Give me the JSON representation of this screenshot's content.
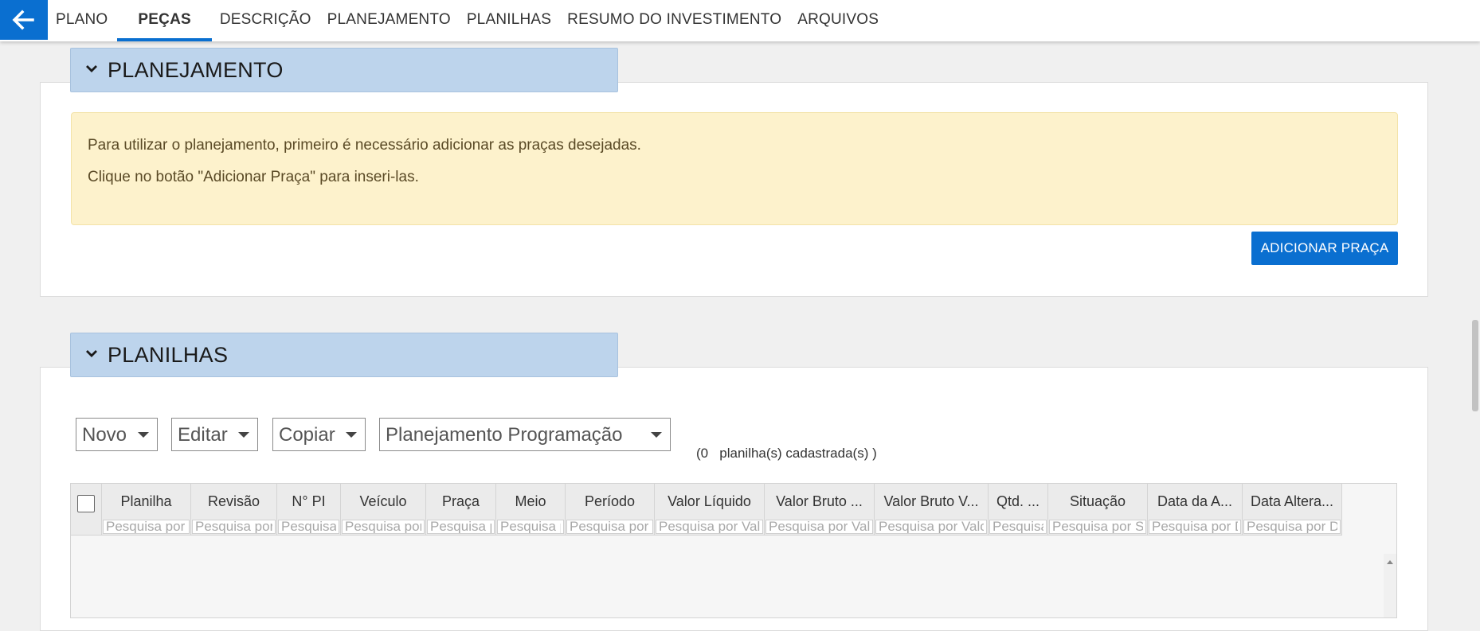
{
  "nav": {
    "tabs": [
      {
        "label": "PLANO"
      },
      {
        "label": "PEÇAS",
        "active": true
      },
      {
        "label": "DESCRIÇÃO"
      },
      {
        "label": "PLANEJAMENTO"
      },
      {
        "label": "PLANILHAS"
      },
      {
        "label": "RESUMO DO INVESTIMENTO"
      },
      {
        "label": "ARQUIVOS"
      }
    ]
  },
  "planejamento": {
    "title": "PLANEJAMENTO",
    "alert_line1": "Para utilizar o planejamento, primeiro é necessário adicionar as praças desejadas.",
    "alert_line2": "Clique no botão \"Adicionar Praça\" para inseri-las.",
    "add_button": "ADICIONAR PRAÇA"
  },
  "planilhas": {
    "title": "PLANILHAS",
    "toolbar": {
      "novo": "Novo",
      "editar": "Editar",
      "copiar": "Copiar",
      "programacao": "Planejamento Programação"
    },
    "count": "(0   planilha(s) cadastrada(s) )",
    "columns": [
      {
        "header": "Planilha",
        "placeholder": "Pesquisa por Planilha"
      },
      {
        "header": "Revisão",
        "placeholder": "Pesquisa por Revisão"
      },
      {
        "header": "N° PI",
        "placeholder": "Pesquisa por N° PI"
      },
      {
        "header": "Veículo",
        "placeholder": "Pesquisa por Veículo"
      },
      {
        "header": "Praça",
        "placeholder": "Pesquisa por Praça"
      },
      {
        "header": "Meio",
        "placeholder": "Pesquisa por Meio"
      },
      {
        "header": "Período",
        "placeholder": "Pesquisa por Período"
      },
      {
        "header": "Valor Líquido",
        "placeholder": "Pesquisa por Valor Líquido"
      },
      {
        "header": "Valor Bruto ...",
        "placeholder": "Pesquisa por Valor Bruto"
      },
      {
        "header": "Valor Bruto V...",
        "placeholder": "Pesquisa por Valor Bruto"
      },
      {
        "header": "Qtd. ...",
        "placeholder": "Pesquisa por Qtd."
      },
      {
        "header": "Situação",
        "placeholder": "Pesquisa por Situação"
      },
      {
        "header": "Data da A...",
        "placeholder": "Pesquisa por Data"
      },
      {
        "header": "Data Altera...",
        "placeholder": "Pesquisa por Data"
      }
    ]
  },
  "colors": {
    "accent": "#0a6fd0",
    "section_header": "#bdd4ec",
    "alert_bg": "#fdf2cc"
  }
}
